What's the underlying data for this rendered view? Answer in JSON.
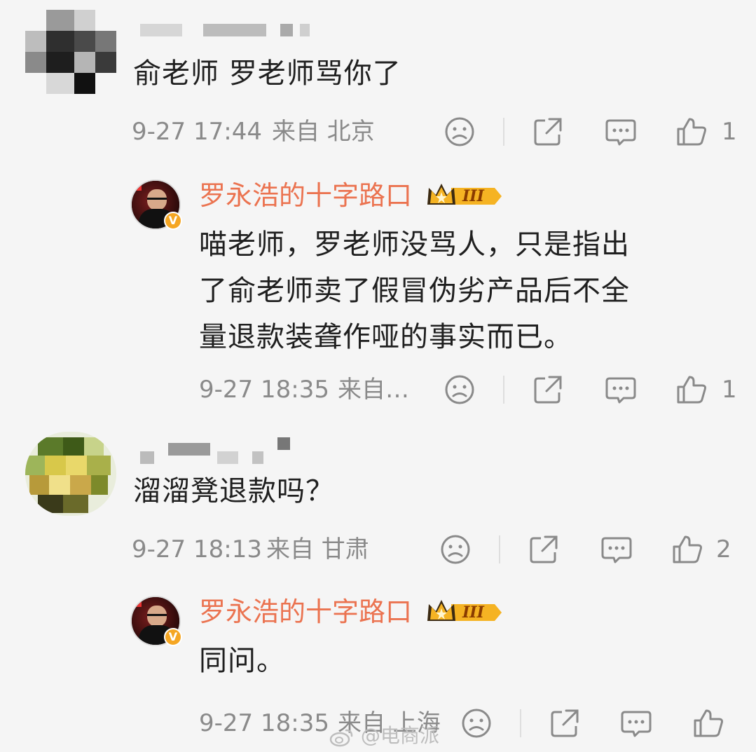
{
  "comments": [
    {
      "text": "俞老师 罗老师骂你了",
      "time": "9-27 17:44",
      "location": "来自 北京",
      "likes": "1",
      "reply": {
        "name": "罗永浩的十字路口",
        "badge": "III",
        "text_lines": [
          "喵老师，罗老师没骂人，只是指出",
          "了俞老师卖了假冒伪劣产品后不全",
          "量退款装聋作哑的事实而已。"
        ],
        "time": "9-27 18:35",
        "location": "来自…",
        "likes": "1"
      }
    },
    {
      "text": "溜溜凳退款吗？",
      "time": "9-27 18:13",
      "location": "来自 甘肃",
      "likes": "2",
      "reply": {
        "name": "罗永浩的十字路口",
        "badge": "III",
        "text_lines": [
          "同问。"
        ],
        "time": "9-27 18:35",
        "location": "来自 上海",
        "likes": ""
      }
    }
  ],
  "verified_mark": "V",
  "watermark": "@电商派",
  "icons": [
    "sad-face-icon",
    "share-icon",
    "comment-icon",
    "thumbs-up-icon"
  ],
  "colors": {
    "name_orange": "#eb7350",
    "meta_gray": "#8a8a8a",
    "badge_gold": "#f5b323"
  }
}
